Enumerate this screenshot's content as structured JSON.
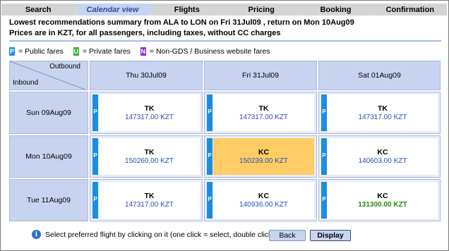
{
  "steps": [
    "Search",
    "Calendar view",
    "Flights",
    "Pricing",
    "Booking",
    "Confirmation"
  ],
  "active_step_index": 1,
  "summary": {
    "line1": "Lowest recommendations summary from ALA to LON on Fri 31Jul09 , return on Mon 10Aug09",
    "line2": "Prices are in KZT, for all passengers, including taxes, without CC charges"
  },
  "legend": {
    "public": {
      "badge": "P",
      "label": "= Public fares",
      "color": "#1c8ee0"
    },
    "private": {
      "badge": "U",
      "label": "= Private fares",
      "color": "#36b02a"
    },
    "nongds": {
      "badge": "N",
      "label": "= Non-GDS / Business website fares",
      "color": "#8a2be2"
    }
  },
  "grid": {
    "corner_outbound": "Outbound",
    "corner_inbound": "Inbound",
    "columns": [
      "Thu 30Jul09",
      "Fri 31Jul09",
      "Sat 01Aug09"
    ],
    "rows": [
      {
        "label": "Sun 09Aug09",
        "cells": [
          {
            "fare": "P",
            "airline": "TK",
            "price": "147317.00 KZT"
          },
          {
            "fare": "P",
            "airline": "TK",
            "price": "147317.00 KZT"
          },
          {
            "fare": "P",
            "airline": "TK",
            "price": "147317.00 KZT"
          }
        ]
      },
      {
        "label": "Mon 10Aug09",
        "cells": [
          {
            "fare": "P",
            "airline": "TK",
            "price": "150260.00 KZT"
          },
          {
            "fare": "P",
            "airline": "KC",
            "price": "150239.00 KZT",
            "selected": true
          },
          {
            "fare": "P",
            "airline": "KC",
            "price": "140603.00 KZT"
          }
        ]
      },
      {
        "label": "Tue 11Aug09",
        "cells": [
          {
            "fare": "P",
            "airline": "TK",
            "price": "147317.00 KZT"
          },
          {
            "fare": "P",
            "airline": "KC",
            "price": "140936.00 KZT"
          },
          {
            "fare": "P",
            "airline": "KC",
            "price": "131300.00 KZT",
            "cheapest": true
          }
        ]
      }
    ]
  },
  "footer": {
    "info_icon": "info-icon",
    "hint": "Select preferred flight by clicking on it (one click = select, double click = display)",
    "back_label": "Back",
    "display_label": "Display"
  },
  "colors": {
    "header_bg": "#c8d4ef",
    "selected_bg": "#ffcc66",
    "price_text": "#2450b5",
    "cheapest_text": "#2c8a10"
  }
}
